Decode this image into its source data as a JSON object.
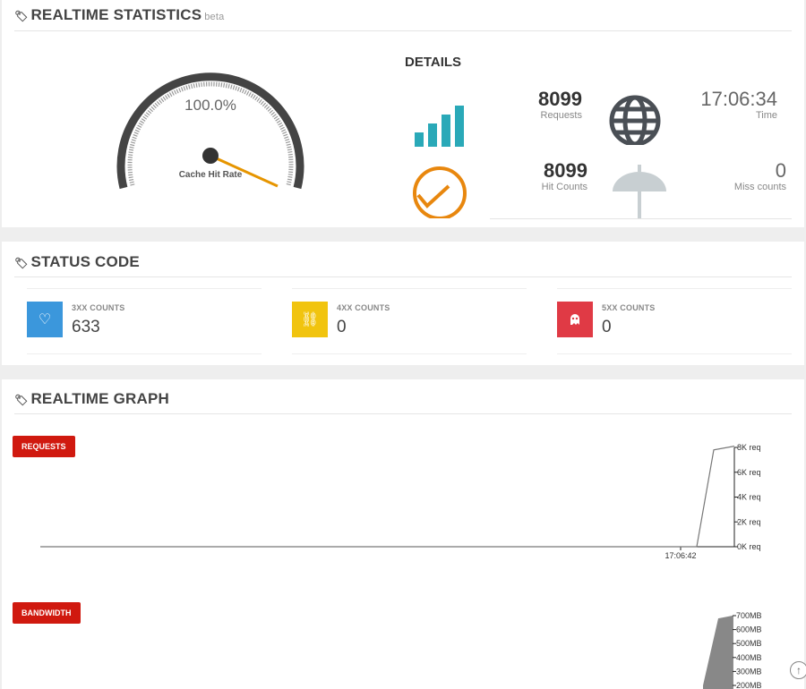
{
  "realtime": {
    "title": "REALTIME STATISTICS",
    "beta": "beta",
    "gauge": {
      "value_text": "100.0%",
      "label": "Cache Hit Rate",
      "value_fraction": 1.0
    },
    "details_title": "DETAILS",
    "requests": {
      "value": "8099",
      "label": "Requests"
    },
    "time": {
      "value": "17:06:34",
      "label": "Time"
    },
    "hit_counts": {
      "value": "8099",
      "label": "Hit Counts"
    },
    "miss_counts": {
      "value": "0",
      "label": "Miss counts"
    }
  },
  "status": {
    "title": "STATUS CODE",
    "cards": [
      {
        "label": "3XX COUNTS",
        "value": "633",
        "color": "#3b97dc",
        "icon": "heart-icon"
      },
      {
        "label": "4XX COUNTS",
        "value": "0",
        "color": "#f1c40f",
        "icon": "broken-link-icon"
      },
      {
        "label": "5XX COUNTS",
        "value": "0",
        "color": "#e03a45",
        "icon": "ghost-icon"
      }
    ]
  },
  "graph": {
    "title": "REALTIME GRAPH",
    "requests_tag": "REQUESTS",
    "bandwidth_tag": "BANDWIDTH"
  },
  "chart_data": [
    {
      "type": "line",
      "title": "REQUESTS",
      "x_tick_labels": [
        "17:06:42"
      ],
      "y_ticks": [
        "0K req",
        "2K req",
        "4K req",
        "6K req",
        "8K req"
      ],
      "ylim": [
        0,
        8000
      ],
      "series": [
        {
          "values": [
            0,
            0,
            7800,
            8099
          ]
        }
      ]
    },
    {
      "type": "area",
      "title": "BANDWIDTH",
      "y_ticks": [
        "200MB",
        "300MB",
        "400MB",
        "500MB",
        "600MB",
        "700MB"
      ],
      "ylim": [
        200,
        700
      ],
      "series": [
        {
          "values": [
            200,
            680,
            700
          ]
        }
      ]
    }
  ]
}
